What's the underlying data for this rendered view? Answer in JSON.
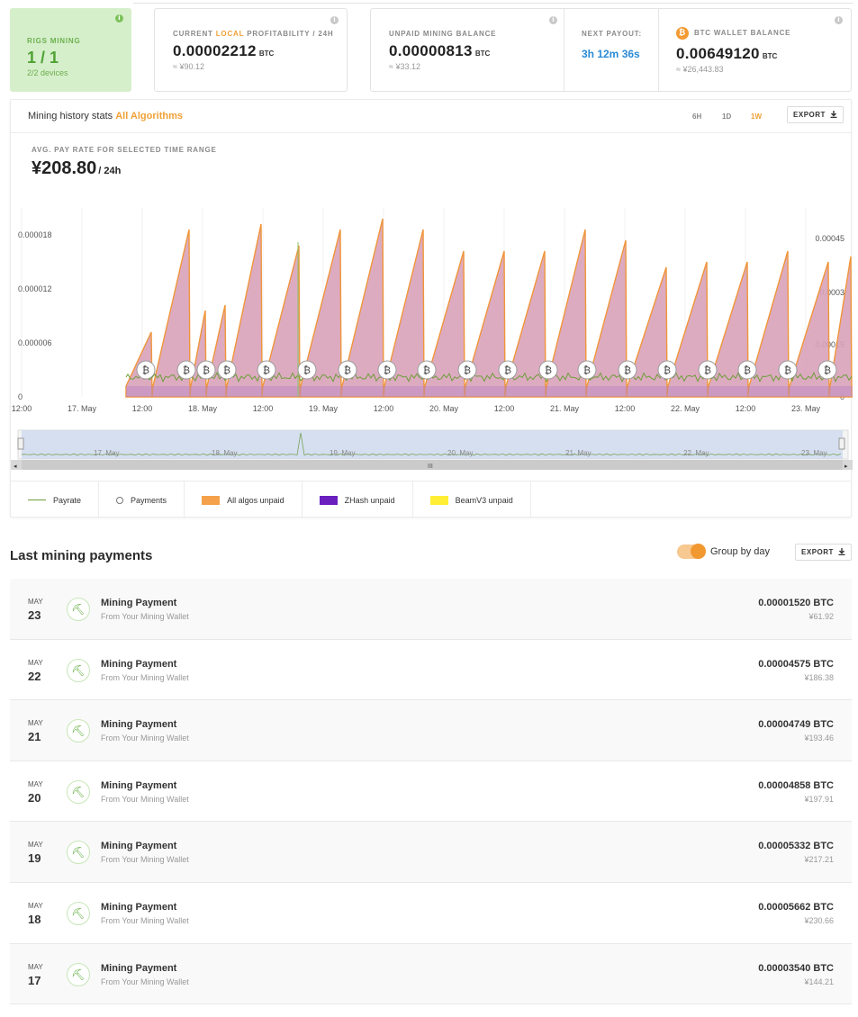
{
  "stats": {
    "rigs": {
      "label": "RIGS MINING",
      "value": "1 / 1",
      "devices": "2/2 devices"
    },
    "profitability": {
      "label_pre": "CURRENT",
      "label_local": "LOCAL",
      "label_post": "PROFITABILITY / 24H",
      "value": "0.00002212",
      "unit": "BTC",
      "fiat": "≈ ¥90.12"
    },
    "unpaid": {
      "label": "UNPAID MINING BALANCE",
      "value": "0.00000813",
      "unit": "BTC",
      "fiat": "≈ ¥33.12"
    },
    "next_payout": {
      "label": "NEXT PAYOUT:",
      "value": "3h 12m 36s"
    },
    "wallet": {
      "label": "BTC WALLET BALANCE",
      "coin": "₿",
      "value": "0.00649120",
      "unit": "BTC",
      "fiat": "≈ ¥26,443.83"
    }
  },
  "history": {
    "title": "Mining history stats",
    "algorithm": "All Algorithms",
    "ranges": [
      "6H",
      "1D",
      "1W"
    ],
    "active_range": "1W",
    "export": "EXPORT",
    "avg_label": "AVG. PAY RATE FOR SELECTED TIME RANGE",
    "avg_value": "¥208.80",
    "avg_per": "/ 24h"
  },
  "chart_data": {
    "type": "area",
    "y_left_ticks": [
      "0.000018",
      "0.000012",
      "0.000006",
      "0"
    ],
    "y_right_ticks": [
      "0.00045",
      "0.0003",
      "0.00015",
      "0"
    ],
    "x_ticks": [
      "12:00",
      "17. May",
      "12:00",
      "18. May",
      "12:00",
      "19. May",
      "12:00",
      "20. May",
      "12:00",
      "21. May",
      "12:00",
      "22. May",
      "12:00",
      "23. May"
    ],
    "navigator_ticks": [
      "17. May",
      "18. May",
      "19. May",
      "20. May",
      "21. May",
      "22. May",
      "23. May"
    ],
    "series": [
      {
        "name": "Payrate",
        "color": "#6d9e3a"
      },
      {
        "name": "Payments",
        "color": "#777777"
      },
      {
        "name": "All algos unpaid",
        "color": "#f5a04a"
      },
      {
        "name": "ZHash unpaid",
        "color": "#6a1fbf"
      },
      {
        "name": "BeamV3 unpaid",
        "color": "#ffee33"
      }
    ],
    "unpaid_peaks": [
      7.2e-06,
      1.86e-05,
      9.6e-06,
      1.02e-05,
      1.92e-05,
      1.68e-05,
      1.86e-05,
      1.98e-05,
      1.86e-05,
      1.62e-05,
      1.62e-05,
      1.62e-05,
      1.86e-05,
      1.74e-05,
      1.44e-05,
      1.5e-05,
      1.5e-05,
      1.62e-05,
      1.5e-05,
      1.56e-05
    ],
    "payment_count": 18
  },
  "legend": [
    "Payrate",
    "Payments",
    "All algos unpaid",
    "ZHash unpaid",
    "BeamV3 unpaid"
  ],
  "payments": {
    "title": "Last mining payments",
    "group_label": "Group by day",
    "export": "EXPORT",
    "rows": [
      {
        "month": "MAY",
        "day": "23",
        "title": "Mining Payment",
        "from": "From Your Mining Wallet",
        "amount": "0.00001520 BTC",
        "fiat": "¥61.92"
      },
      {
        "month": "MAY",
        "day": "22",
        "title": "Mining Payment",
        "from": "From Your Mining Wallet",
        "amount": "0.00004575 BTC",
        "fiat": "¥186.38"
      },
      {
        "month": "MAY",
        "day": "21",
        "title": "Mining Payment",
        "from": "From Your Mining Wallet",
        "amount": "0.00004749 BTC",
        "fiat": "¥193.46"
      },
      {
        "month": "MAY",
        "day": "20",
        "title": "Mining Payment",
        "from": "From Your Mining Wallet",
        "amount": "0.00004858 BTC",
        "fiat": "¥197.91"
      },
      {
        "month": "MAY",
        "day": "19",
        "title": "Mining Payment",
        "from": "From Your Mining Wallet",
        "amount": "0.00005332 BTC",
        "fiat": "¥217.21"
      },
      {
        "month": "MAY",
        "day": "18",
        "title": "Mining Payment",
        "from": "From Your Mining Wallet",
        "amount": "0.00005662 BTC",
        "fiat": "¥230.66"
      },
      {
        "month": "MAY",
        "day": "17",
        "title": "Mining Payment",
        "from": "From Your Mining Wallet",
        "amount": "0.00003540 BTC",
        "fiat": "¥144.21"
      }
    ]
  }
}
